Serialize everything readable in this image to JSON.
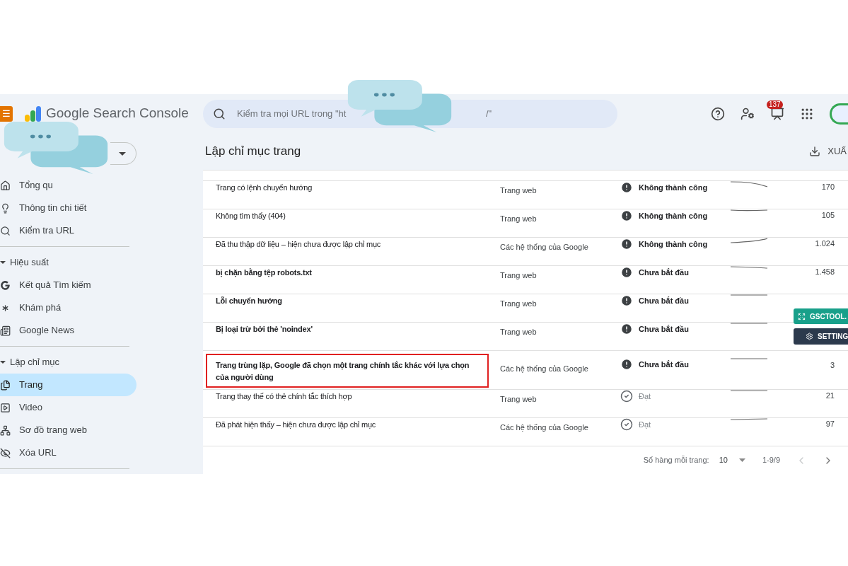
{
  "app": {
    "logo_text": "Google Search Console",
    "menu_glyph": "☰"
  },
  "search": {
    "placeholder": "Kiểm tra mọi URL trong \"ht",
    "visible_tail": "/\""
  },
  "header": {
    "notification_count": "137"
  },
  "sidebar": {
    "top_items": [
      {
        "label": "Tổng qu",
        "selected": false
      },
      {
        "label": "Thông tin chi tiết",
        "selected": false
      },
      {
        "label": "Kiểm tra URL",
        "selected": false
      }
    ],
    "sections": [
      {
        "label": "Hiệu suất",
        "expanded": true,
        "children": [
          {
            "label": "Kết quả Tìm kiếm",
            "selected": false
          },
          {
            "label": "Khám phá",
            "selected": false
          },
          {
            "label": "Google News",
            "selected": false
          }
        ]
      },
      {
        "label": "Lập chỉ mục",
        "expanded": true,
        "children": [
          {
            "label": "Trang",
            "selected": true
          },
          {
            "label": "Video",
            "selected": false
          },
          {
            "label": "Sơ đồ trang web",
            "selected": false
          },
          {
            "label": "Xóa URL",
            "selected": false
          }
        ]
      }
    ]
  },
  "page": {
    "title": "Lập chỉ mục trang",
    "export_label": "XUẤ"
  },
  "table": {
    "rows": [
      {
        "reason": "Trang có lệnh chuyển hướng",
        "bold": false,
        "highlighted": false,
        "source": "Trang web",
        "status": "Không thành công",
        "kind": "error",
        "pages": "170"
      },
      {
        "reason": "Không tìm thấy (404)",
        "bold": false,
        "highlighted": false,
        "source": "Trang web",
        "status": "Không thành công",
        "kind": "error",
        "pages": "105"
      },
      {
        "reason": "Đã thu thập dữ liệu – hiện chưa được lập chỉ mục",
        "bold": false,
        "highlighted": false,
        "source": "Các hệ thống của Google",
        "status": "Không thành công",
        "kind": "error",
        "pages": "1.024"
      },
      {
        "reason": "bị chặn bằng tệp robots.txt",
        "bold": true,
        "highlighted": false,
        "source": "Trang web",
        "status": "Chưa bắt đầu",
        "kind": "error",
        "pages": "1.458"
      },
      {
        "reason": "Lỗi chuyển hướng",
        "bold": true,
        "highlighted": false,
        "source": "Trang web",
        "status": "Chưa bắt đầu",
        "kind": "error"
      },
      {
        "reason": "Bị loại trừ bởi thẻ 'noindex'",
        "bold": true,
        "highlighted": false,
        "source": "Trang web",
        "status": "Chưa bắt đầu",
        "kind": "error"
      },
      {
        "reason": "Trang trùng lặp, Google đã chọn một trang chính tắc khác với lựa chọn của người dùng",
        "bold": true,
        "highlighted": true,
        "source": "Các hệ thống của Google",
        "status": "Chưa bắt đầu",
        "kind": "error",
        "pages": "3"
      },
      {
        "reason": "Trang thay thế có thẻ chính tắc thích hợp",
        "bold": false,
        "highlighted": false,
        "source": "Trang web",
        "status": "Đạt",
        "kind": "passed",
        "pages": "21"
      },
      {
        "reason": "Đã phát hiện thấy – hiện chưa được lập chỉ mục",
        "bold": false,
        "highlighted": false,
        "source": "Các hệ thống của Google",
        "status": "Đạt",
        "kind": "passed",
        "pages": "97"
      }
    ]
  },
  "pagination": {
    "rows_label": "Số hàng mỗi trang:",
    "rows_value": "10",
    "range": "1-9/9",
    "prev_disabled": true,
    "next_disabled": false
  },
  "overlay_buttons": {
    "tool_label": "GSCTOOL.",
    "settings_label": "SETTING"
  }
}
